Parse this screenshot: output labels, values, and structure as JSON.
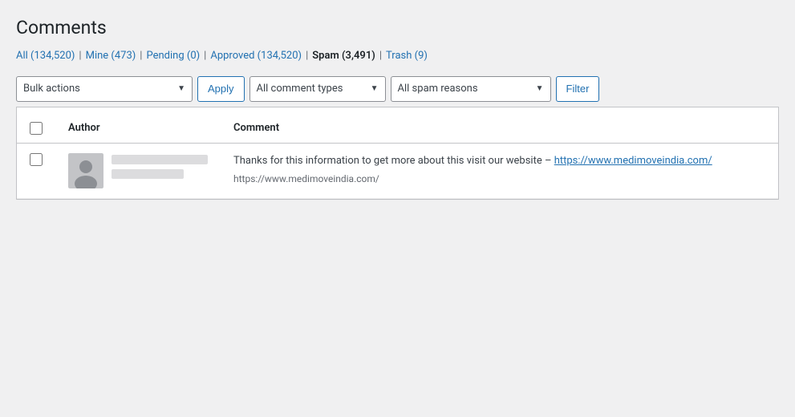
{
  "page": {
    "title": "Comments"
  },
  "filter_links": [
    {
      "id": "all",
      "label": "All",
      "count": "134,520",
      "active": false
    },
    {
      "id": "mine",
      "label": "Mine",
      "count": "473",
      "active": false
    },
    {
      "id": "pending",
      "label": "Pending",
      "count": "0",
      "active": false
    },
    {
      "id": "approved",
      "label": "Approved",
      "count": "134,520",
      "active": false
    },
    {
      "id": "spam",
      "label": "Spam",
      "count": "3,491",
      "active": true
    },
    {
      "id": "trash",
      "label": "Trash",
      "count": "9",
      "active": false
    }
  ],
  "toolbar": {
    "bulk_actions_label": "Bulk actions",
    "apply_label": "Apply",
    "comment_types_label": "All comment types",
    "spam_reasons_label": "All spam reasons",
    "filter_label": "Filter"
  },
  "table": {
    "columns": [
      {
        "id": "author",
        "label": "Author"
      },
      {
        "id": "comment",
        "label": "Comment"
      }
    ],
    "rows": [
      {
        "id": 1,
        "comment_text_before": "Thanks for this information to get more about this visit our website – ",
        "comment_link_text": "https://www.medimoveindia.com/",
        "comment_link_href": "https://www.medimoveindia.com/",
        "comment_url_display": "https://www.medimoveindia.com/"
      }
    ]
  }
}
